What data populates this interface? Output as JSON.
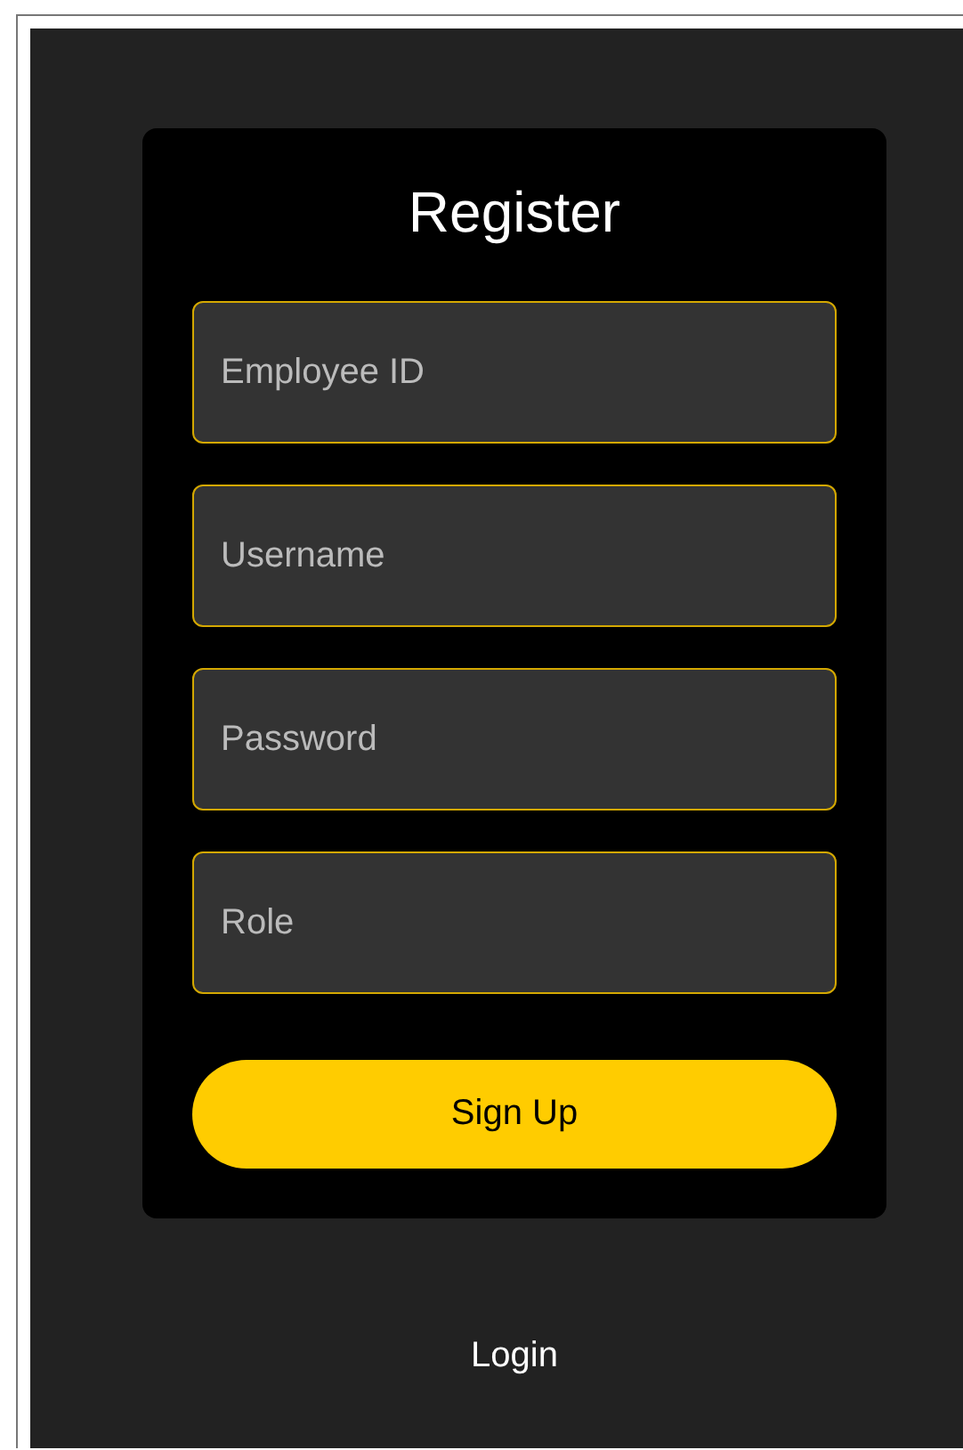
{
  "form": {
    "title": "Register",
    "fields": [
      {
        "placeholder": "Employee ID"
      },
      {
        "placeholder": "Username"
      },
      {
        "placeholder": "Password"
      },
      {
        "placeholder": "Role"
      }
    ],
    "submit_button": "Sign Up"
  },
  "login_link": "Login"
}
